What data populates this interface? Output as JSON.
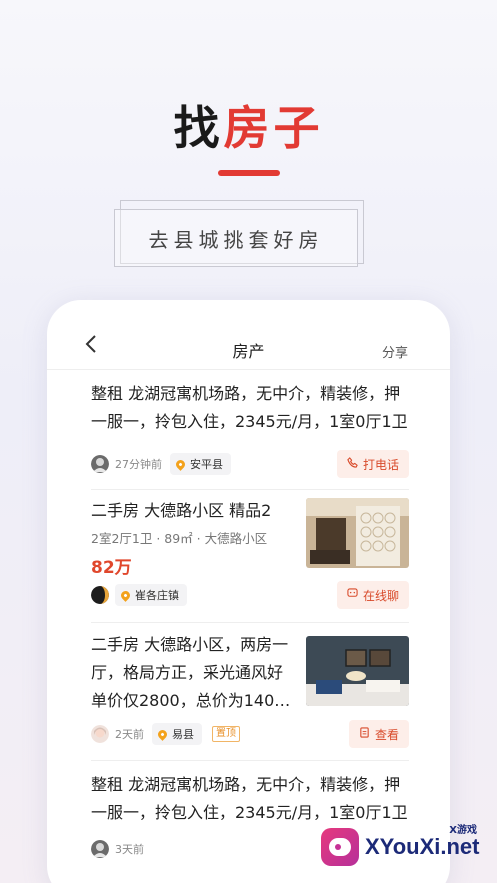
{
  "promo": {
    "title_part1": "找",
    "title_part2": "房子",
    "subtitle": "去县城挑套好房"
  },
  "navbar": {
    "back_icon": "chevron-left-icon",
    "title": "房产",
    "share_label": "分享"
  },
  "listings": [
    {
      "title": "整租 龙湖冠寓机场路，无中介，精装修，押一服一，拎包入住，2345元/月，1室0厅1卫",
      "time": "27分钟前",
      "location": "安平县",
      "action_label": "打电话",
      "action_icon": "phone-icon"
    },
    {
      "title": "二手房 大德路小区 精品2",
      "subtitle": "2室2厅1卫 · 89㎡ · 大德路小区",
      "price": "82万",
      "time": "",
      "location": "崔各庄镇",
      "action_label": "在线聊",
      "action_icon": "chat-icon"
    },
    {
      "title": "二手房 大德路小区，两房一厅，格局方正，采光通风好单价仅2800，总价为140…",
      "time": "2天前",
      "location": "易县",
      "badge": "置顶",
      "action_label": "查看",
      "action_icon": "document-icon"
    },
    {
      "title": "整租 龙湖冠寓机场路，无中介，精装修，押一服一，拎包入住，2345元/月，1室0厅1卫",
      "time": "3天前"
    }
  ],
  "watermark": {
    "text": "XYouXi.net",
    "small_text": "X游戏"
  },
  "colors": {
    "accent": "#e23a33",
    "action_bg": "#fdeee9",
    "action_text": "#d84a2a",
    "price": "#e0472c"
  }
}
